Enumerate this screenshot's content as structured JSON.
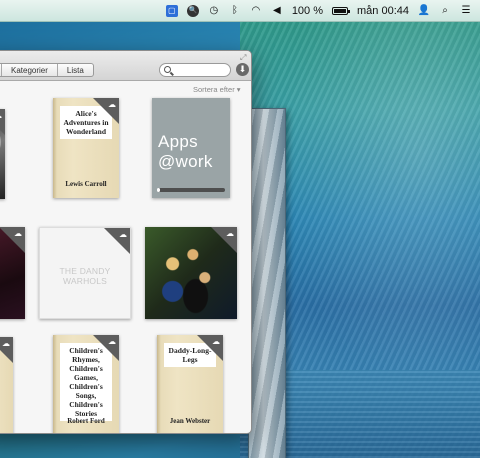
{
  "menubar": {
    "battery_percent": "100 %",
    "battery_level": 1.0,
    "clock": "mån 00:44"
  },
  "toolbar": {
    "tabs": [
      "",
      "Kategorier",
      "Lista"
    ],
    "search_placeholder": ""
  },
  "sort": {
    "label": "Sortera efter ▾"
  },
  "library": {
    "items": [
      {
        "type": "book",
        "title": "Alice's Adventures in Wonderland",
        "author": "Lewis Carroll"
      },
      {
        "type": "app",
        "title_line1": "Apps",
        "title_line2": "@work",
        "progress": 0.05
      },
      {
        "type": "album",
        "title": "THE DANDY WARHOLS"
      },
      {
        "type": "book",
        "title": "Children's Rhymes, Children's Games, Children's Songs, Children's Stories",
        "author": "Robert Ford"
      },
      {
        "type": "book",
        "title": "Daddy-Long-Legs",
        "author": "Jean Webster"
      }
    ]
  },
  "colors": {
    "badge": "#5d5d5d",
    "window_bg": "#f6f6f6",
    "book_paper": "#efe4c4"
  }
}
